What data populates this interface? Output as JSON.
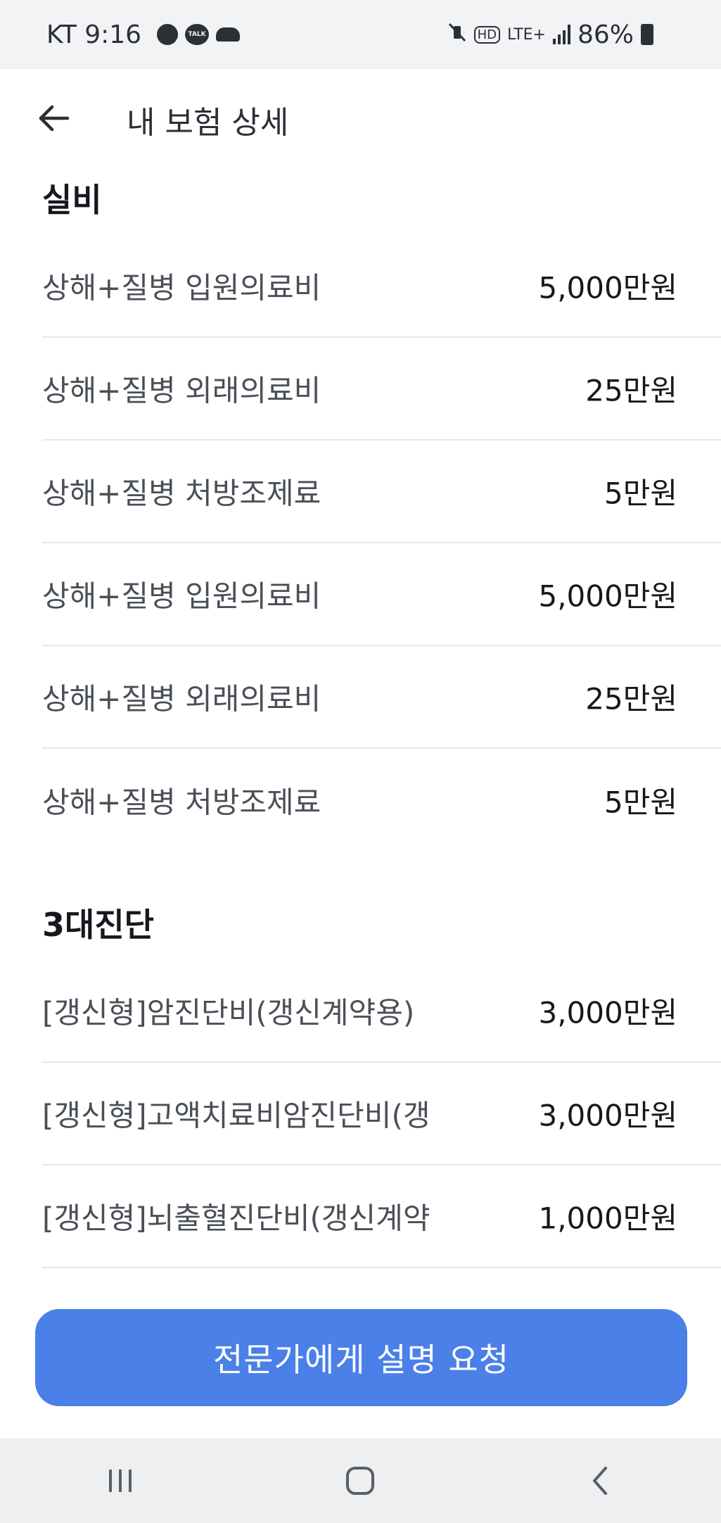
{
  "status_bar": {
    "carrier_time": "KT 9:16",
    "talk_text": "TALK",
    "network": "LTE+",
    "hd": "HD",
    "battery": "86%"
  },
  "header": {
    "title": "내 보험 상세"
  },
  "sections": [
    {
      "title": "실비",
      "rows": [
        {
          "label": "상해+질병 입원의료비",
          "value": "5,000만원"
        },
        {
          "label": "상해+질병 외래의료비",
          "value": "25만원"
        },
        {
          "label": "상해+질병 처방조제료",
          "value": "5만원"
        },
        {
          "label": "상해+질병 입원의료비",
          "value": "5,000만원"
        },
        {
          "label": "상해+질병 외래의료비",
          "value": "25만원"
        },
        {
          "label": "상해+질병 처방조제료",
          "value": "5만원"
        }
      ]
    },
    {
      "title": "3대진단",
      "rows": [
        {
          "label": "[갱신형]암진단비(갱신계약용)",
          "value": "3,000만원"
        },
        {
          "label": "[갱신형]고액치료비암진단비(갱",
          "value": "3,000만원"
        },
        {
          "label": "[갱신형]뇌출혈진단비(갱신계약",
          "value": "1,000만원"
        }
      ]
    }
  ],
  "cta": {
    "label": "전문가에게 설명 요청"
  },
  "colors": {
    "accent": "#4a80e8",
    "status_bar_bg": "#f2f3f5",
    "divider": "#e6e7ea"
  },
  "icons": {
    "back": "arrow-left-icon",
    "nav_recents": "recent-apps-icon",
    "nav_home": "home-icon",
    "nav_back": "chevron-left-icon"
  }
}
